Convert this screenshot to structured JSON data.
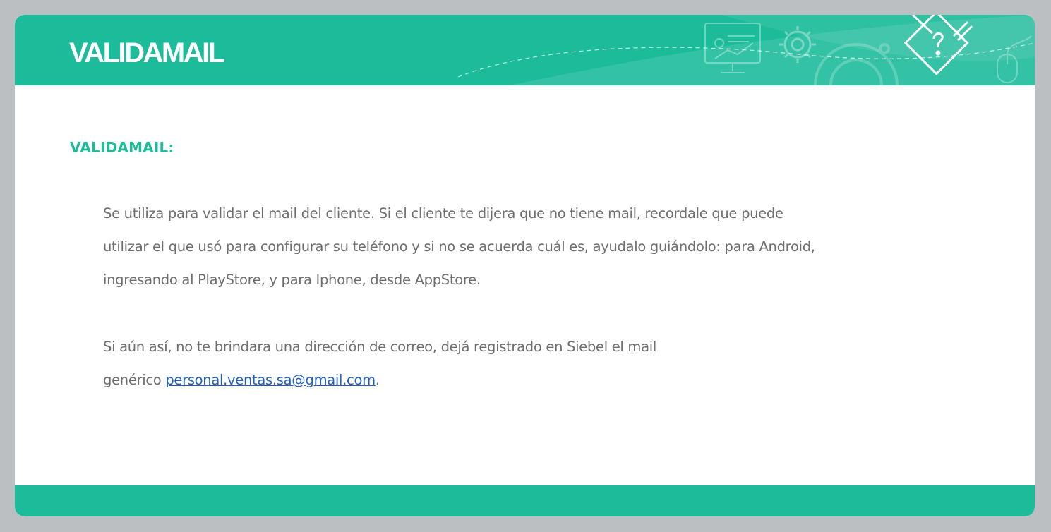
{
  "header": {
    "brand": "VALIDAMAIL",
    "icons": [
      "presentation-screen-icon",
      "gear-icon",
      "large-gear-icon",
      "pencil-question-badge-icon",
      "mouse-icon"
    ]
  },
  "content": {
    "title": "VALIDAMAIL:",
    "paragraph1": {
      "line1": "Se utiliza para validar el mail del cliente. Si el cliente te dijera que no tiene mail, recordale que puede",
      "line2": "utilizar el que usó para configurar su teléfono y si no se acuerda cuál es, ayudalo guiándolo: para Android,",
      "line3": "ingresando al PlayStore, y para Iphone, desde AppStore."
    },
    "paragraph2": {
      "line1": "Si aún así, no te brindara una dirección de correo, dejá registrado en Siebel el mail",
      "line2_prefix": "genérico ",
      "email": "personal.ventas.sa@gmail.com",
      "line2_suffix": "."
    }
  },
  "colors": {
    "accent": "#1cbc9b",
    "text": "#6d6e70",
    "link": "#1f5fbf",
    "background": "#bcbfc2"
  }
}
